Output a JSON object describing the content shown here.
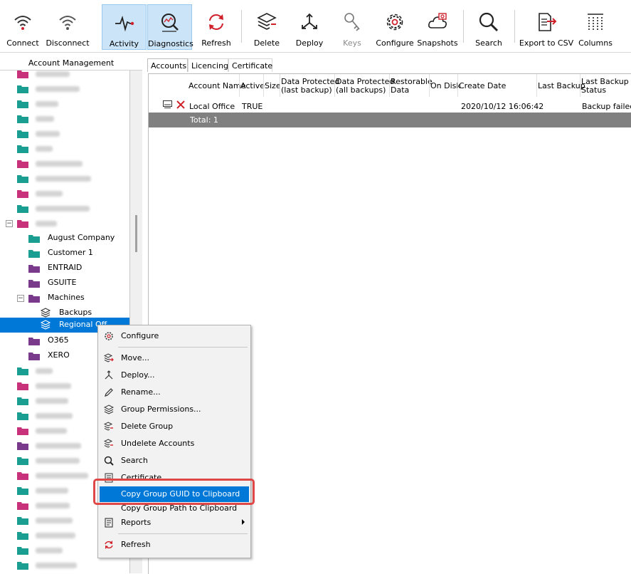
{
  "toolbar": {
    "connect": "Connect",
    "disconnect": "Disconnect",
    "activity": "Activity",
    "diagnostics": "Diagnostics",
    "refresh": "Refresh",
    "delete": "Delete",
    "deploy": "Deploy",
    "keys": "Keys",
    "configure": "Configure",
    "snapshots": "Snapshots",
    "search": "Search",
    "export_csv": "Export to CSV",
    "columns": "Columns"
  },
  "left_panel": {
    "header": "Account Management",
    "tree": {
      "august_company": "August Company",
      "customer_1": "Customer 1",
      "entraid": "ENTRAID",
      "gsuite": "GSUITE",
      "machines": "Machines",
      "backups": "Backups",
      "regional_office": "Regional Off",
      "o365": "O365",
      "xero": "XERO"
    }
  },
  "tabs": {
    "accounts": "Accounts",
    "licencing": "Licencing",
    "certificate": "Certificate"
  },
  "grid": {
    "columns": {
      "account_name": "Account Name",
      "active": "Active",
      "size": "Size",
      "dp_last_1": "Data Protected",
      "dp_last_2": "(last backup)",
      "dp_all_1": "Data Protected",
      "dp_all_2": "(all backups)",
      "restorable_1": "Restorable",
      "restorable_2": "Data",
      "on_disk": "On Disk",
      "create_date": "Create Date",
      "last_backup": "Last Backup",
      "last_backup_status_1": "Last Backup",
      "last_backup_status_2": "Status"
    },
    "row": {
      "account_name": "Local Office",
      "active": "TRUE",
      "create_date": "2020/10/12 16:06:42",
      "last_backup_status": "Backup failed t"
    },
    "total": "Total: 1"
  },
  "context_menu": {
    "configure": "Configure",
    "move": "Move...",
    "deploy": "Deploy...",
    "rename": "Rename...",
    "group_permissions": "Group Permissions...",
    "delete_group": "Delete Group",
    "undelete_accounts": "Undelete Accounts",
    "search": "Search",
    "certificate": "Certificate",
    "copy_guid": "Copy Group GUID to Clipboard",
    "copy_path": "Copy Group Path to Clipboard",
    "reports": "Reports",
    "refresh": "Refresh"
  },
  "colors": {
    "selection": "#0078d7",
    "highlight_box": "#e04848",
    "folder_teal": "#1a9e92",
    "folder_pink": "#c8327a",
    "folder_purple": "#7a3a8c"
  }
}
